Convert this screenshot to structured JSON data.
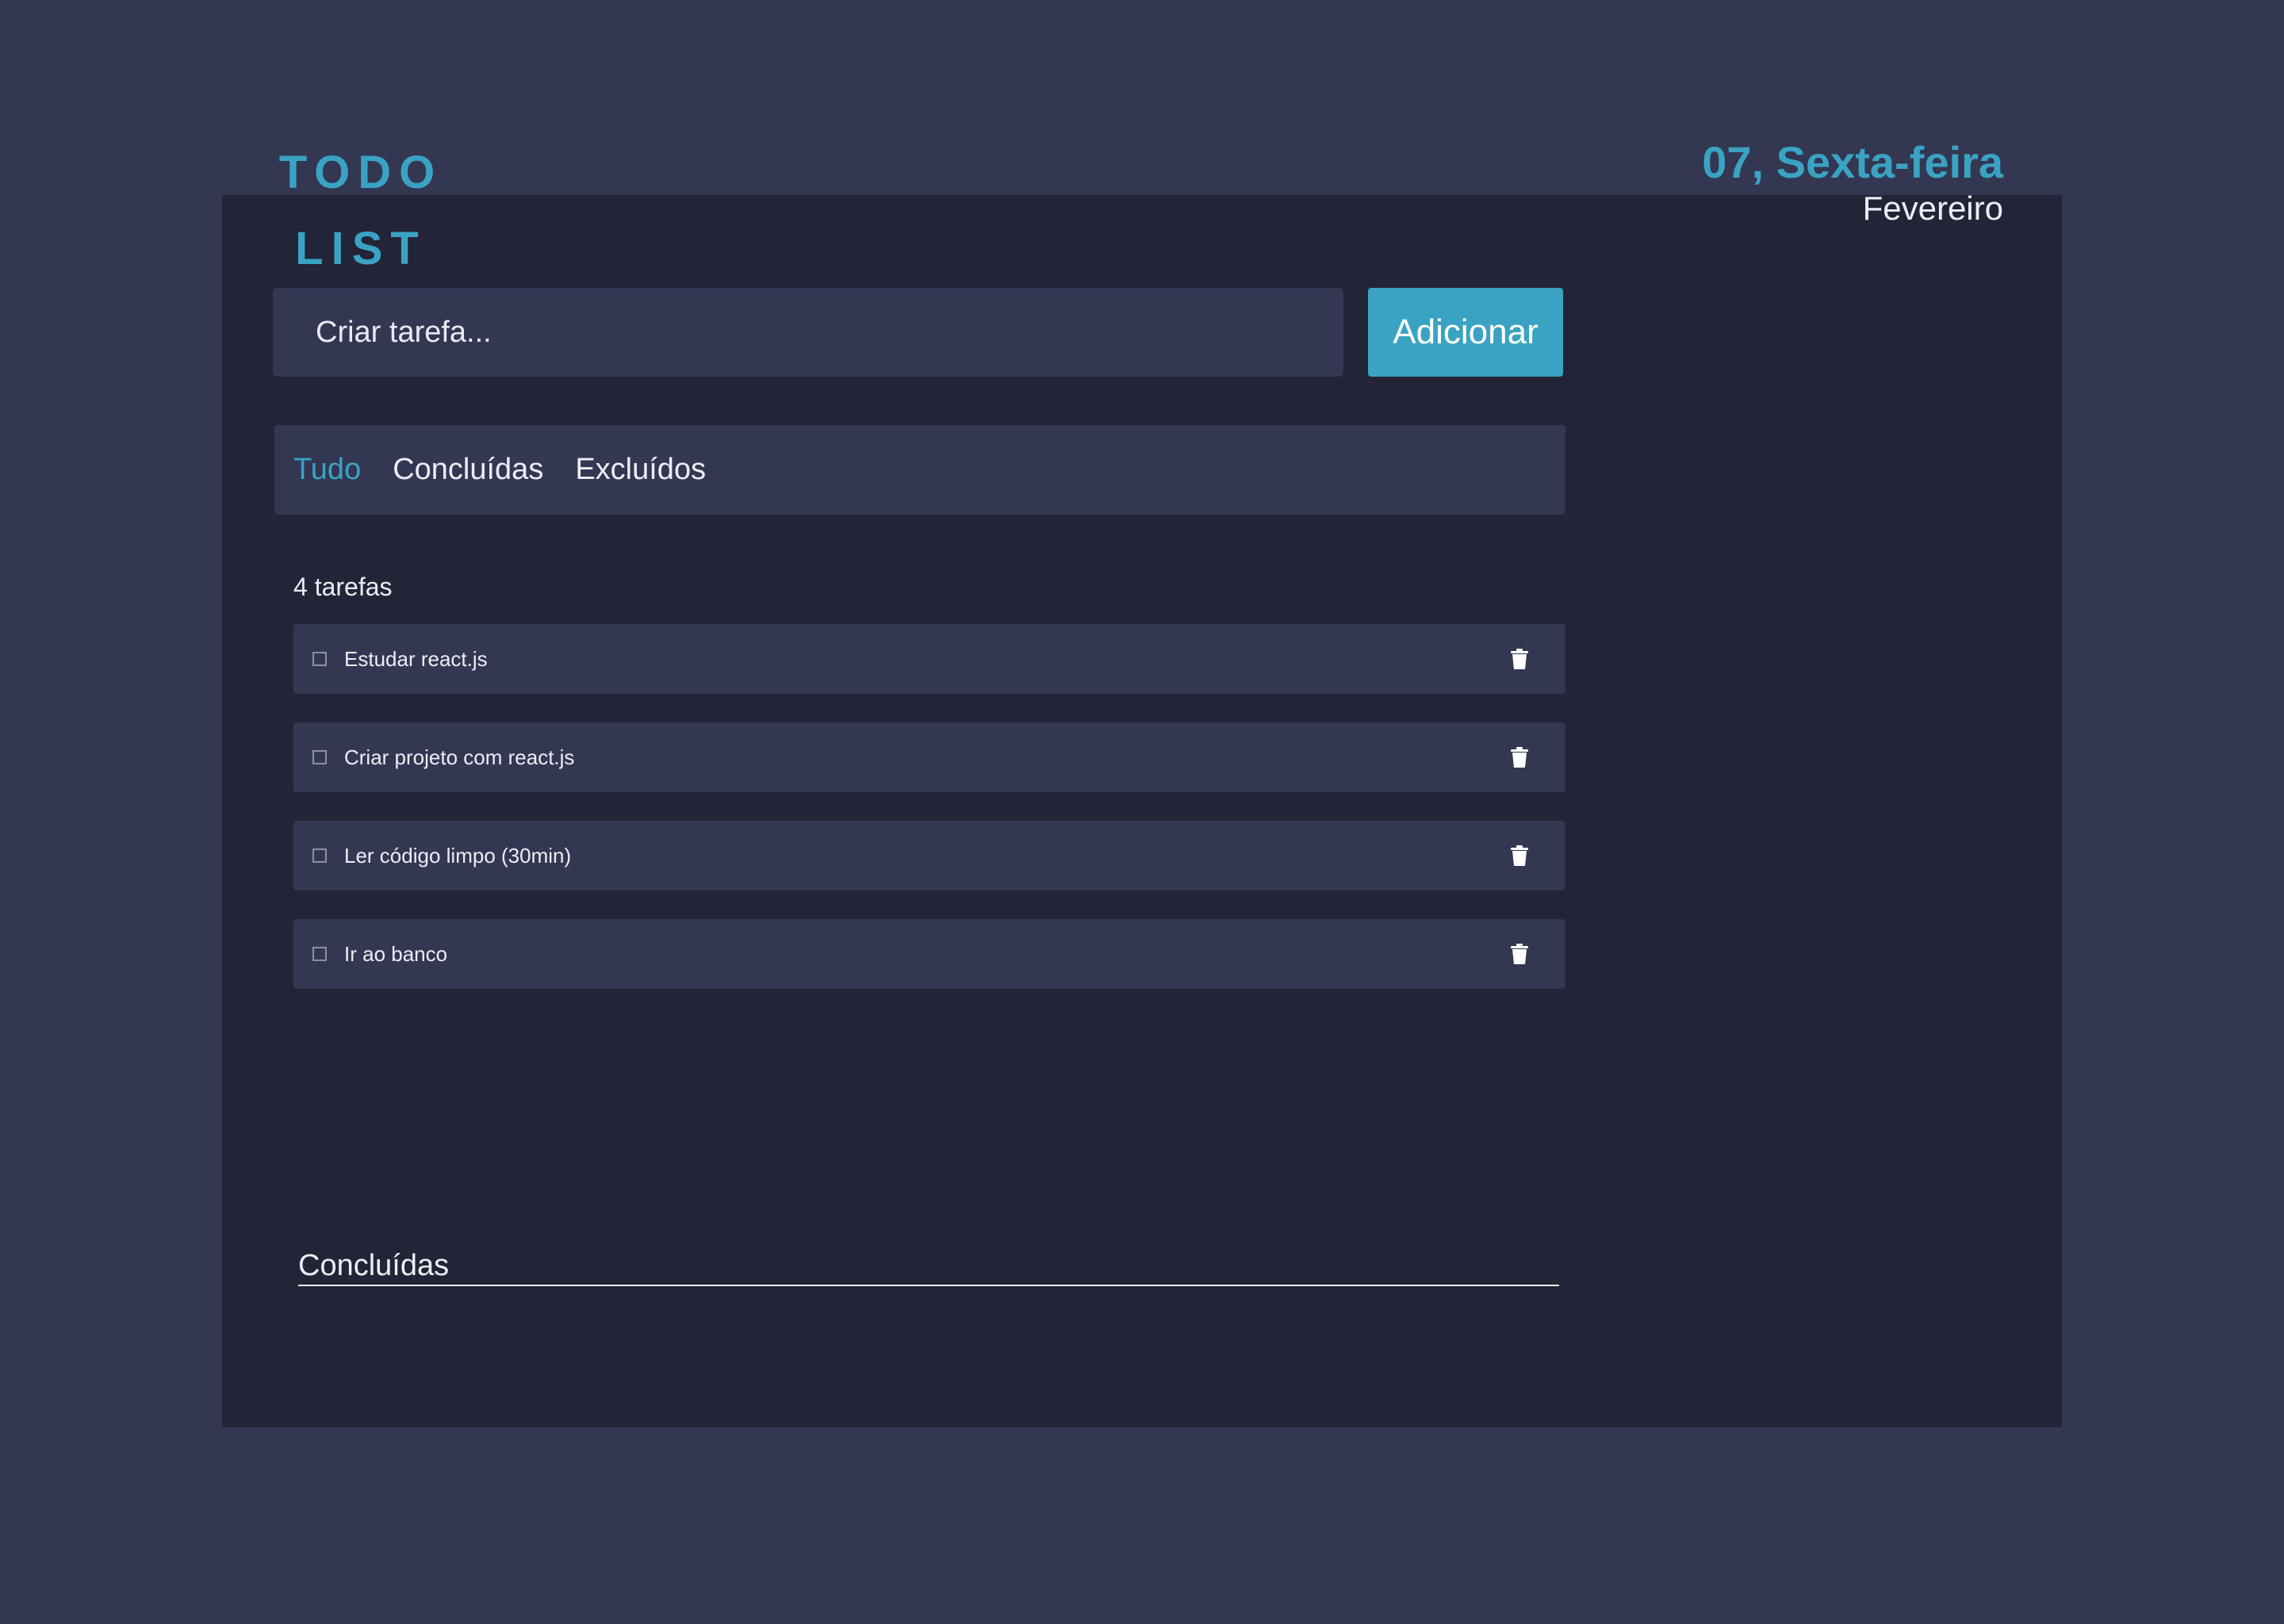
{
  "logo": {
    "line1": "TODO",
    "line2": "LIST"
  },
  "date": {
    "day": "07, Sexta-feira",
    "month": "Fevereiro"
  },
  "input": {
    "placeholder": "Criar tarefa...",
    "value": ""
  },
  "add_button": {
    "label": "Adicionar"
  },
  "tabs": [
    {
      "label": "Tudo",
      "active": true
    },
    {
      "label": "Concluídas",
      "active": false
    },
    {
      "label": "Excluídos",
      "active": false
    }
  ],
  "task_count": "4 tarefas",
  "tasks": [
    {
      "text": "Estudar react.js",
      "done": false
    },
    {
      "text": "Criar projeto com react.js",
      "done": false
    },
    {
      "text": "Ler código limpo (30min)",
      "done": false
    },
    {
      "text": "Ir ao banco",
      "done": false
    }
  ],
  "completed_section": {
    "title": "Concluídas"
  },
  "colors": {
    "page_background": "#333752",
    "app_background": "#232437",
    "panel": "#333752",
    "accent": "#3aa3c4",
    "text": "#eceef5"
  },
  "icons": {
    "delete": "trash-icon",
    "checkbox": "checkbox-icon"
  }
}
